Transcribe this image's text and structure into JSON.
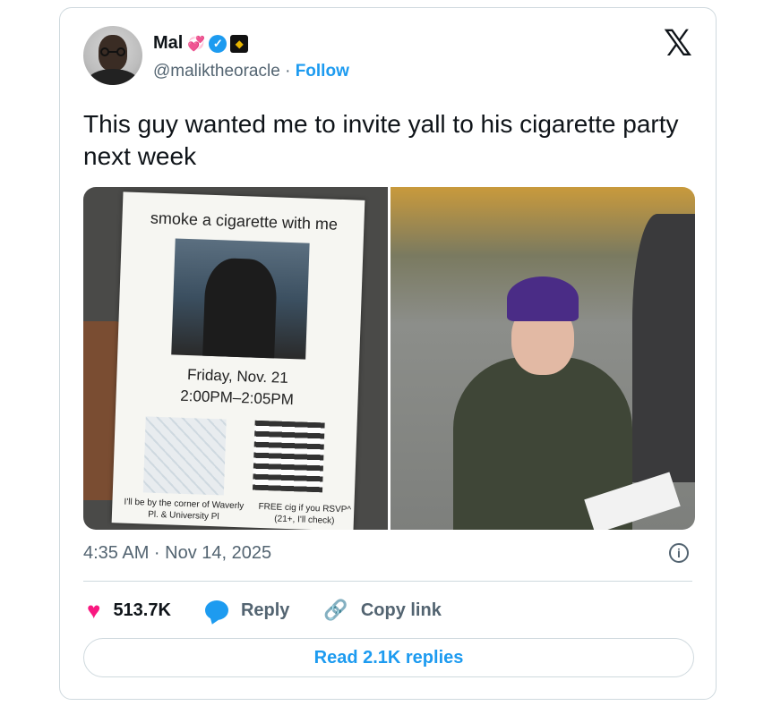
{
  "author": {
    "name": "Mal",
    "emoji_hearts": "💞",
    "handle": "@maliktheoracle",
    "separator": "·",
    "follow_label": "Follow"
  },
  "tweet": {
    "text": "This guy wanted me to invite yall to his cigarette party next week",
    "timestamp": "4:35 AM · Nov 14, 2025"
  },
  "media": {
    "flyer_title": "smoke a cigarette with me",
    "flyer_date": "Friday, Nov. 21",
    "flyer_time": "2:00PM–2:05PM",
    "flyer_location": "I'll be by the corner of Waverly Pl. & University Pl",
    "flyer_free": "FREE cig if you RSVP^ (21+, I'll check)"
  },
  "actions": {
    "likes": "513.7K",
    "reply_label": "Reply",
    "copy_label": "Copy link"
  },
  "read_replies_label": "Read 2.1K replies",
  "colors": {
    "accent": "#1d9bf0",
    "like": "#f91880",
    "muted": "#536471",
    "border": "#cfd9de"
  },
  "icons": [
    "x-logo-icon",
    "verified-badge-icon",
    "affiliate-badge-icon",
    "heart-icon",
    "reply-icon",
    "link-icon",
    "info-icon"
  ]
}
